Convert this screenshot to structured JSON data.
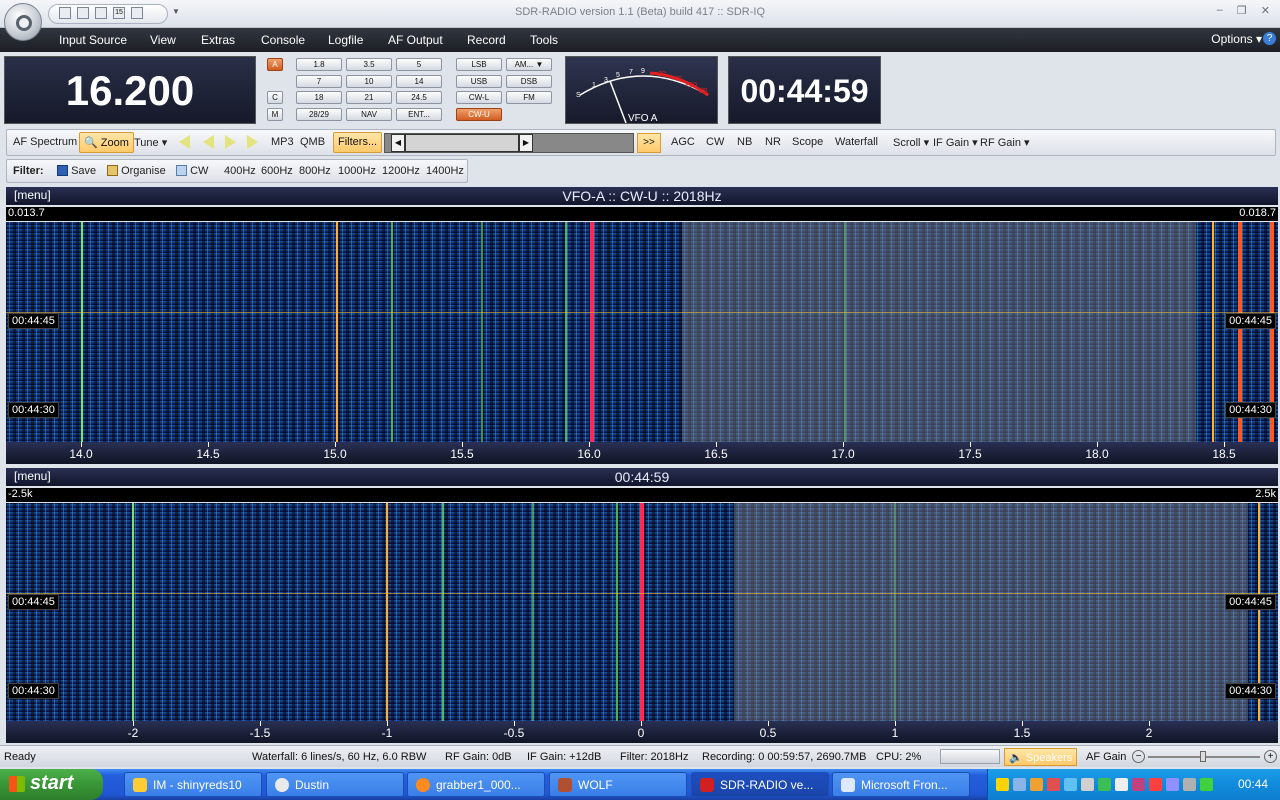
{
  "window": {
    "title": "SDR-RADIO version 1.1 (Beta) build 417 :: SDR-IQ"
  },
  "quick_access": {
    "date_badge": "15"
  },
  "menubar": {
    "items": [
      "Input Source",
      "View",
      "Extras",
      "Console",
      "Logfile",
      "AF Output",
      "Record",
      "Tools"
    ],
    "options_label": "Options",
    "help_label": "?"
  },
  "displays": {
    "frequency": "16.200",
    "clock": "00:44:59"
  },
  "vfo_selector": {
    "a": "A",
    "c": "C",
    "m": "M"
  },
  "band_buttons": [
    "1.8",
    "3.5",
    "5",
    "7",
    "10",
    "14",
    "18",
    "21",
    "24.5",
    "28/29",
    "NAV",
    "ENT..."
  ],
  "mode_buttons": [
    "LSB",
    "AM...",
    "USB",
    "DSB",
    "CW-L",
    "FM",
    "CW-U"
  ],
  "active_mode": "CW-U",
  "smeter": {
    "label": "VFO A",
    "scale_white": [
      "S",
      "1",
      "3",
      "5",
      "7",
      "9"
    ],
    "scale_red": [
      "+20",
      "+40",
      "+60",
      "dB"
    ]
  },
  "toolbar1": {
    "af_spectrum": "AF Spectrum",
    "zoom": "Zoom",
    "tune": "Tune",
    "mp3": "MP3",
    "qmb": "QMB",
    "filters": "Filters...",
    "go": ">>",
    "agc": "AGC",
    "cw": "CW",
    "nb": "NB",
    "nr": "NR",
    "scope": "Scope",
    "waterfall": "Waterfall",
    "scroll": "Scroll",
    "if_gain": "IF Gain",
    "rf_gain": "RF Gain"
  },
  "toolbar2": {
    "filter_label": "Filter:",
    "save": "Save",
    "organise": "Organise",
    "cw": "CW",
    "presets": [
      "400Hz",
      "600Hz",
      "800Hz",
      "1000Hz",
      "1200Hz",
      "1400Hz"
    ]
  },
  "waterfall_top": {
    "menu": "[menu]",
    "title": "VFO-A  ::  CW-U  ::  2018Hz",
    "left_edge": "0.013.7",
    "right_edge": "0.018.7",
    "time_marks": [
      "00:44:45",
      "00:44:30"
    ],
    "axis_labels": [
      "14.0",
      "14.5",
      "15.0",
      "15.5",
      "16.0",
      "16.5",
      "17.0",
      "17.5",
      "18.0",
      "18.5"
    ]
  },
  "waterfall_bottom": {
    "menu": "[menu]",
    "title": "00:44:59",
    "left_edge": "-2.5k",
    "right_edge": "2.5k",
    "time_marks": [
      "00:44:45",
      "00:44:30"
    ],
    "axis_labels": [
      "-2",
      "-1.5",
      "-1",
      "-0.5",
      "0",
      "0.5",
      "1",
      "1.5",
      "2"
    ]
  },
  "statusbar": {
    "ready": "Ready",
    "waterfall": "Waterfall: 6 lines/s, 60 Hz, 6.0 RBW",
    "rf_gain": "RF Gain: 0dB",
    "if_gain": "IF Gain: +12dB",
    "filter": "Filter: 2018Hz",
    "recording": "Recording: 0 00:59:57, 2690.7MB",
    "cpu": "CPU: 2%",
    "speakers": "Speakers",
    "af_gain": "AF Gain"
  },
  "taskbar": {
    "start": "start",
    "tasks": [
      "IM - shinyreds10",
      "Dustin",
      "grabber1_000...",
      "WOLF",
      "SDR-RADIO ve...",
      "Microsoft Fron..."
    ],
    "clock": "00:44"
  }
}
